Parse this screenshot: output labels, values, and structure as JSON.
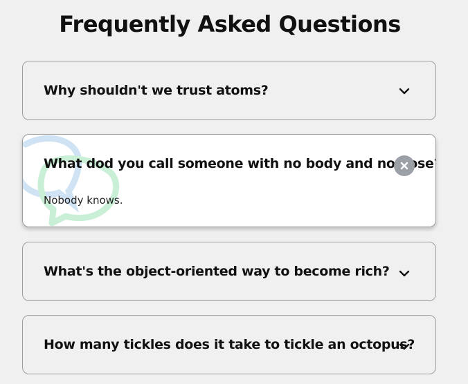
{
  "page": {
    "title": "Frequently Asked Questions"
  },
  "faqs": [
    {
      "question": "Why shouldn't we trust atoms?",
      "answer": "",
      "expanded": false,
      "icon": "chevron-down-icon"
    },
    {
      "question": "What dod you call someone with no body and no nose?",
      "answer": "Nobody knows.",
      "expanded": true,
      "icon": "close-icon"
    },
    {
      "question": "What's the object-oriented way to become rich?",
      "answer": "",
      "expanded": false,
      "icon": "chevron-down-icon"
    },
    {
      "question": "How many tickles does it take to tickle an octopus?",
      "answer": "",
      "expanded": false,
      "icon": "chevron-down-icon"
    }
  ],
  "colors": {
    "background": "#f0f0f0",
    "card_border": "#9e9e9e",
    "active_card": "#ffffff",
    "close_button": "#9aa0a6",
    "deco_blue": "#cfe3f5",
    "deco_green": "#c9efd6"
  }
}
